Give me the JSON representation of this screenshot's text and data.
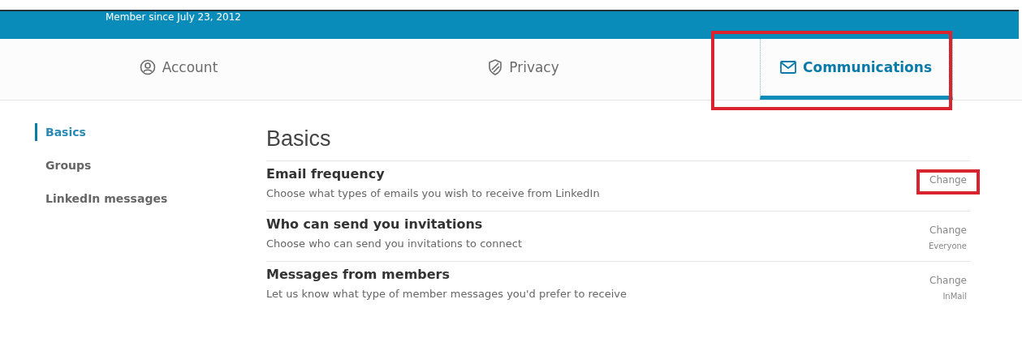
{
  "banner": {
    "member_since": "Member since July 23, 2012"
  },
  "tabs": [
    {
      "label": "Account",
      "selected": false,
      "highlighted": false
    },
    {
      "label": "Privacy",
      "selected": false,
      "highlighted": false
    },
    {
      "label": "Communications",
      "selected": true,
      "highlighted": true
    }
  ],
  "sidebar": {
    "items": [
      {
        "label": "Basics",
        "selected": true
      },
      {
        "label": "Groups",
        "selected": false
      },
      {
        "label": "LinkedIn messages",
        "selected": false
      }
    ]
  },
  "section": {
    "heading": "Basics",
    "rows": [
      {
        "title": "Email frequency",
        "description": "Choose what types of emails you wish to receive from LinkedIn",
        "action": "Change",
        "highlighted": true
      },
      {
        "title": "Who can send you invitations",
        "description": "Choose who can send you invitations to connect",
        "action": "Change",
        "value": "Everyone",
        "highlighted": false
      },
      {
        "title": "Messages from members",
        "description": "Let us know what type of member messages you'd prefer to receive",
        "action": "Change",
        "value": "InMail",
        "highlighted": false
      }
    ]
  }
}
